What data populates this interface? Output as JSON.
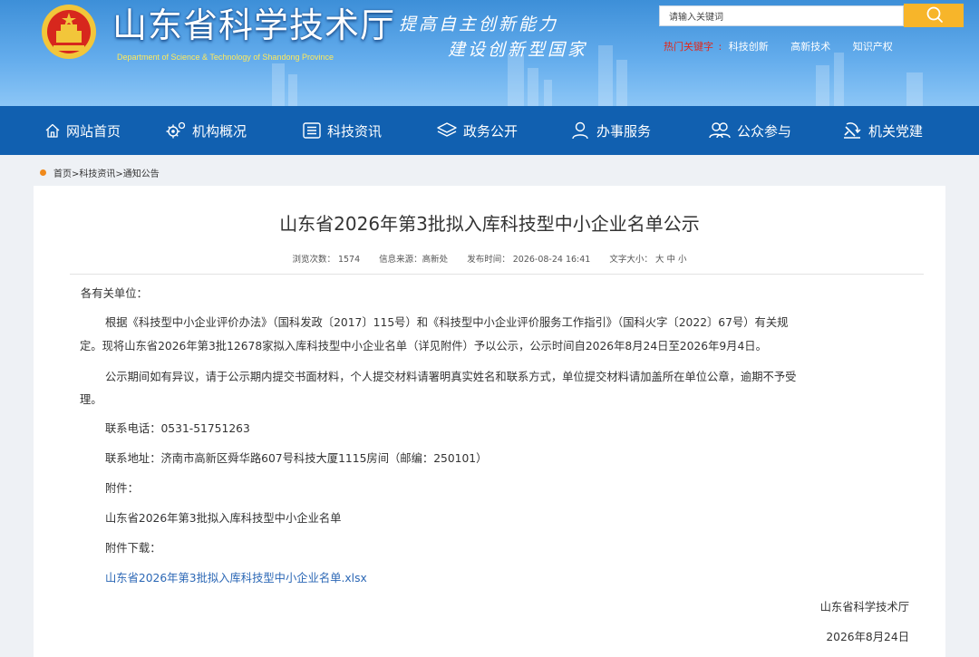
{
  "header": {
    "title": "山东省科学技术厅",
    "title_en": "Department of Science & Technology of Shandong Province",
    "slogan_line1": "提高自主创新能力",
    "slogan_line2": "建设创新型国家",
    "search_placeholder": "请输入关键词",
    "hot_label": "热门关键字",
    "hot_sep": ":",
    "hot_links": [
      "科技创新",
      "高新技术",
      "知识产权"
    ],
    "icons": {
      "emblem": "national-emblem-icon",
      "search": "search-icon"
    },
    "colors": {
      "header_blue": "#4d9be2",
      "nav_blue": "#1160b0",
      "search_btn": "#f7b52a",
      "hot_red": "#e0281c"
    }
  },
  "nav": {
    "items": [
      {
        "label": "网站首页",
        "icon": "home-icon"
      },
      {
        "label": "机构概况",
        "icon": "gear-icon"
      },
      {
        "label": "科技资讯",
        "icon": "news-icon"
      },
      {
        "label": "政务公开",
        "icon": "layers-icon"
      },
      {
        "label": "办事服务",
        "icon": "user-icon"
      },
      {
        "label": "公众参与",
        "icon": "group-icon"
      },
      {
        "label": "机关党建",
        "icon": "party-icon"
      }
    ]
  },
  "breadcrumb": {
    "text": "首页>科技资讯>通知公告"
  },
  "article": {
    "title": "山东省2026年第3批拟入库科技型中小企业名单公示",
    "meta": {
      "views": "浏览次数： 1574",
      "source": "信息来源：高新处",
      "date": "发布时间： 2026-08-24 16:41",
      "font_label": "文字大小：",
      "size_large": "大",
      "size_medium": "中",
      "size_small": "小"
    },
    "greeting": "各有关单位：",
    "para1_line1": "根据《科技型中小企业评价办法》（国科发政〔2017〕115号）和《科技型中小企业评价服务工作指引》（国科火字〔2022〕67号）有关规",
    "para1_line2": "定。现将山东省2026年第3批12678家拟入库科技型中小企业名单（详见附件）予以公示，公示时间自2026年8月24日至2026年9月4日。",
    "para2_line1": "公示期间如有异议，请于公示期内提交书面材料，个人提交材料请署明真实姓名和联系方式，单位提交材料请加盖所在单位公章，逾期不予受",
    "para2_line2": "理。",
    "phone": "联系电话：0531-51751263",
    "address": "联系地址：济南市高新区舜华路607号科技大厦1115房间（邮编：250101）",
    "attachment_label": "附件：",
    "attachment_name": "山东省2026年第3批拟入库科技型中小企业名单",
    "download_label": "附件下载：",
    "download_link": "山东省2026年第3批拟入库科技型中小企业名单.xlsx",
    "signature": "山东省科学技术厅",
    "sign_date": "2026年8月24日",
    "colors": {
      "link": "#2b67b5",
      "breadcrumb_dot": "#f08a1c"
    }
  }
}
